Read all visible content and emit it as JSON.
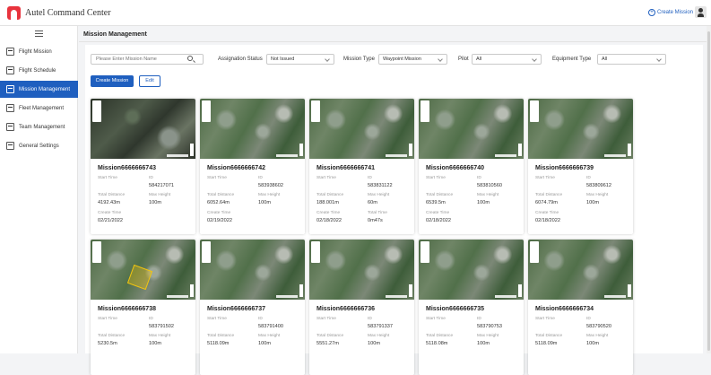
{
  "app": {
    "title": "Autel Command Center",
    "create_mission_top": "Create Mission"
  },
  "sidebar": {
    "items": [
      {
        "label": "Flight Mission",
        "active": false
      },
      {
        "label": "Flight Schedule",
        "active": false
      },
      {
        "label": "Mission Management",
        "active": true
      },
      {
        "label": "Fleet Management",
        "active": false
      },
      {
        "label": "Team Management",
        "active": false
      },
      {
        "label": "General Settings",
        "active": false
      }
    ]
  },
  "page": {
    "title": "Mission Management"
  },
  "filters": {
    "search_placeholder": "Please Enter Mission Name",
    "assignation_label": "Assignation Status",
    "assignation_value": "Not Issued",
    "mission_type_label": "Mission Type",
    "mission_type_value": "Waypoint Mission",
    "pilot_label": "Pilot",
    "pilot_value": "All",
    "equipment_label": "Equipment Type",
    "equipment_value": "All"
  },
  "actions": {
    "create": "Create Mission",
    "edit": "Edit"
  },
  "labels": {
    "start_time": "Start Time",
    "id": "ID",
    "total_distance": "Total Distance",
    "max_height": "Max Height",
    "create_time": "Create Time",
    "total_time": "Total Time"
  },
  "missions": [
    {
      "name": "Mission6666666743",
      "id": "584217071",
      "distance": "4192.43m",
      "height": "100m",
      "create_time": "02/21/2022",
      "thumb": "dark"
    },
    {
      "name": "Mission6666666742",
      "id": "583938602",
      "distance": "6052.64m",
      "height": "100m",
      "create_time": "02/19/2022",
      "thumb": "color"
    },
    {
      "name": "Mission6666666741",
      "id": "583831122",
      "distance": "188.001m",
      "height": "60m",
      "create_time": "02/18/2022",
      "total_time": "0m47s",
      "thumb": "color"
    },
    {
      "name": "Mission6666666740",
      "id": "583810560",
      "distance": "6539.5m",
      "height": "100m",
      "create_time": "02/18/2022",
      "thumb": "color"
    },
    {
      "name": "Mission6666666739",
      "id": "583809612",
      "distance": "6074.79m",
      "height": "100m",
      "create_time": "02/18/2022",
      "thumb": "color"
    },
    {
      "name": "Mission6666666738",
      "id": "583791502",
      "distance": "5230.5m",
      "height": "100m",
      "thumb": "color-yellow"
    },
    {
      "name": "Mission6666666737",
      "id": "583791400",
      "distance": "5118.09m",
      "height": "100m",
      "thumb": "color"
    },
    {
      "name": "Mission6666666736",
      "id": "583791337",
      "distance": "5551.27m",
      "height": "100m",
      "thumb": "color"
    },
    {
      "name": "Mission6666666735",
      "id": "583790753",
      "distance": "5118.08m",
      "height": "100m",
      "thumb": "color"
    },
    {
      "name": "Mission6666666734",
      "id": "583790520",
      "distance": "5118.09m",
      "height": "100m",
      "thumb": "color"
    }
  ],
  "colors": {
    "accent": "#1f5fbf",
    "logo": "#e8333d"
  }
}
